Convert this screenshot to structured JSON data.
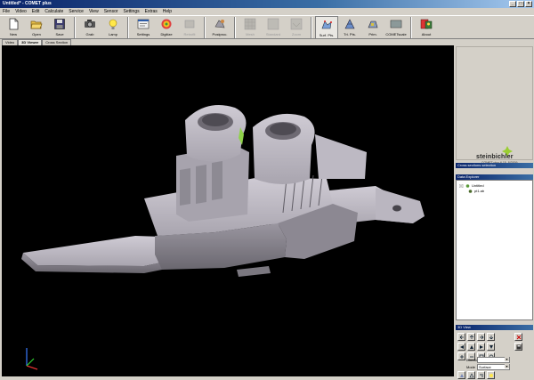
{
  "window": {
    "title": "Untitled* - COMET plus"
  },
  "menu": [
    "File",
    "Video",
    "Edit",
    "Calculate",
    "Service",
    "View",
    "Sensor",
    "Settings",
    "Extras",
    "Help"
  ],
  "toolbar": {
    "groups": [
      [
        {
          "id": "new",
          "label": "New",
          "icon": "new-file-icon"
        },
        {
          "id": "open",
          "label": "Open",
          "icon": "folder-open-icon"
        },
        {
          "id": "save",
          "label": "Save",
          "icon": "floppy-disk-icon"
        }
      ],
      [
        {
          "id": "grab",
          "label": "Grab",
          "icon": "camera-grab-icon"
        },
        {
          "id": "lamp",
          "label": "Lamp",
          "icon": "lamp-icon"
        }
      ],
      [
        {
          "id": "settings",
          "label": "Settings",
          "icon": "settings-icon"
        },
        {
          "id": "digitize",
          "label": "Digitize",
          "icon": "digitize-icon"
        },
        {
          "id": "retro",
          "label": "Retrofit",
          "icon": "retrofit-icon",
          "disabled": true
        }
      ],
      [
        {
          "id": "postproc",
          "label": "Postproc.",
          "icon": "postprocess-icon"
        }
      ],
      [
        {
          "id": "mesh",
          "label": "Mesh",
          "icon": "mesh-icon",
          "disabled": true
        },
        {
          "id": "standard",
          "label": "Standard",
          "icon": "standard-icon",
          "disabled": true
        },
        {
          "id": "zoom",
          "label": "Zoom",
          "icon": "zoom-icon",
          "disabled": true
        }
      ],
      [
        {
          "id": "surf",
          "label": "Surf. Pts.",
          "icon": "surface-points-icon"
        },
        {
          "id": "tritri",
          "label": "Tri. Pts.",
          "icon": "triangle-points-icon"
        },
        {
          "id": "prim",
          "label": "Prim.",
          "icon": "primitives-icon"
        },
        {
          "id": "cometscale",
          "label": "COMETscale",
          "icon": "comet-scale-icon"
        }
      ],
      [
        {
          "id": "about",
          "label": "About",
          "icon": "about-icon"
        }
      ]
    ]
  },
  "tabs": [
    "Video",
    "3D Viewer",
    "Cross Section"
  ],
  "active_tab": "3D Viewer",
  "logo": {
    "brand": "steinbichler",
    "version": "COMET plus 6.15, 8/2009"
  },
  "panels": {
    "cross_sections": "Cross sections selection",
    "data_explorer": "Data Explorer",
    "tree": [
      {
        "label": "Untitled",
        "level": 0
      },
      {
        "label": "pt1.ab",
        "level": 1
      }
    ],
    "view3d": {
      "title": "3D View",
      "direction_label": "Direction",
      "direction_value": "",
      "mode_label": "Mode",
      "mode_value": "Surface"
    }
  },
  "colors": {
    "part": "#b7b3bd",
    "part_dark": "#6e6b73",
    "viewport": "#000000",
    "highlight": "#8fd24a"
  }
}
